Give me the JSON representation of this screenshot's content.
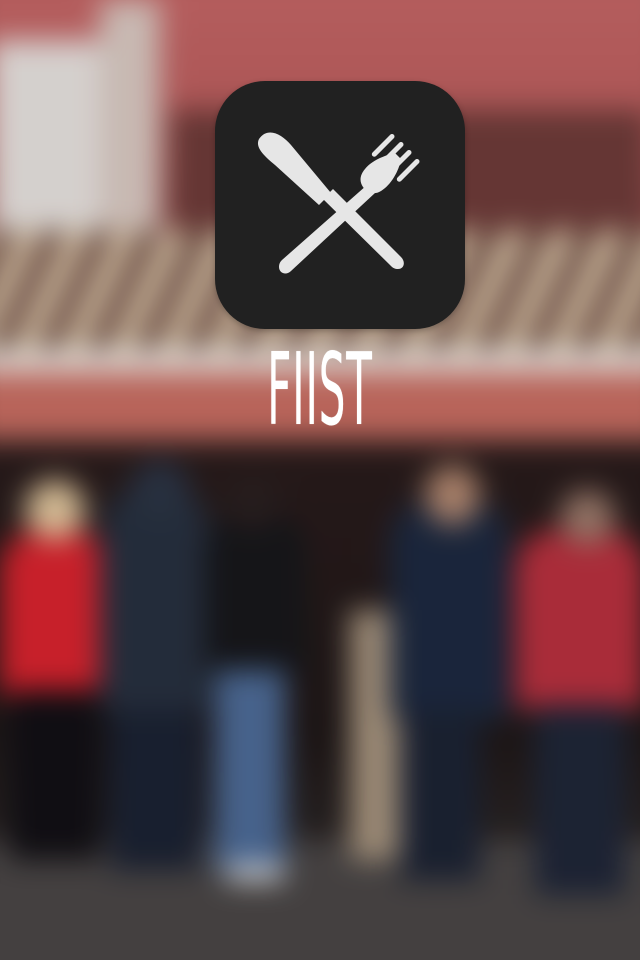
{
  "app": {
    "title": "FIIST",
    "icon": "knife-and-fork-crossed-icon",
    "icon_background": "#212121",
    "icon_foreground": "#E6E6E6"
  },
  "background": {
    "description_tag": "blurred-queue-at-food-stand",
    "accent_colors": [
      "#C76767",
      "#D8232E",
      "#1D2940"
    ]
  }
}
